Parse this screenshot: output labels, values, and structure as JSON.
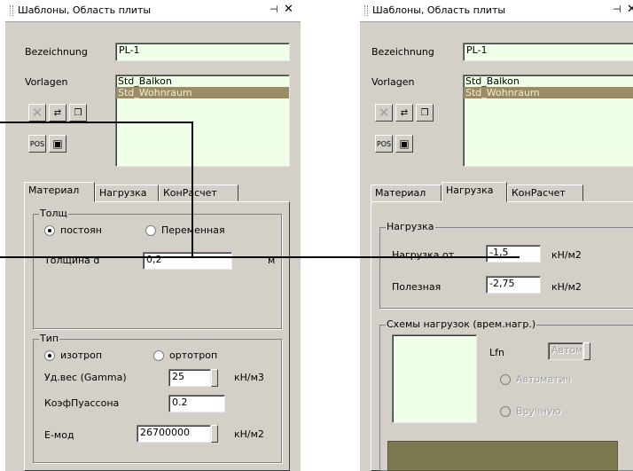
{
  "left": {
    "title": "Шаблоны, Область плиты",
    "pin": "⊣",
    "close": "✕",
    "bezeichnung_label": "Bezeichnung",
    "bezeichnung_value": "PL-1",
    "vorlagen_label": "Vorlagen",
    "vorlagen_items": [
      "Std_Balkon",
      "Std_Wohnraum"
    ],
    "tabs": [
      "Материал",
      "Нагрузка",
      "КонРасчет"
    ],
    "group_thickness": {
      "title": "Толщ",
      "radio_constant": "постоян",
      "radio_variable": "Переменная",
      "thickness_label": "Толщина d",
      "thickness_value": "0,2",
      "thickness_unit": "м"
    },
    "group_type": {
      "title": "Тип",
      "radio_iso": "изотроп",
      "radio_ortho": "ортотроп",
      "weight_label": "Уд.вес (Gamma)",
      "weight_value": "25",
      "weight_unit": "кН/м3",
      "poisson_label": "КоэфПуассона",
      "poisson_value": "0.2",
      "emod_label": "Е-мод",
      "emod_value": "26700000",
      "emod_unit": "кН/м2"
    }
  },
  "right": {
    "title": "Шаблоны, Область плиты",
    "pin": "⊣",
    "close": "✕",
    "bezeichnung_label": "Bezeichnung",
    "bezeichnung_value": "PL-1",
    "vorlagen_label": "Vorlagen",
    "vorlagen_items": [
      "Std_Balkon",
      "Std_Wohnraum"
    ],
    "tabs": [
      "Материал",
      "Нагрузка",
      "КонРасчет"
    ],
    "group_load": {
      "title": "Нагрузка",
      "load_from_label": "Нагрузка от",
      "load_from_value": "-1,5",
      "load_from_unit": "кН/м2",
      "useful_label": "Полезная",
      "useful_value": "-2,75",
      "useful_unit": "кН/м2"
    },
    "group_schemes": {
      "title": "Схемы нагрузок (врем.нагр.)",
      "lfn_label": "Lfn",
      "lfn_value": "Автом",
      "radio_auto": "Автоматич",
      "radio_manual": "Вручную"
    }
  },
  "colors": {
    "panel_bg": "#d4d0c8",
    "field_bg": "#f0ffe8",
    "selection_bg": "#9a8c64",
    "connector_line": "#000000"
  }
}
